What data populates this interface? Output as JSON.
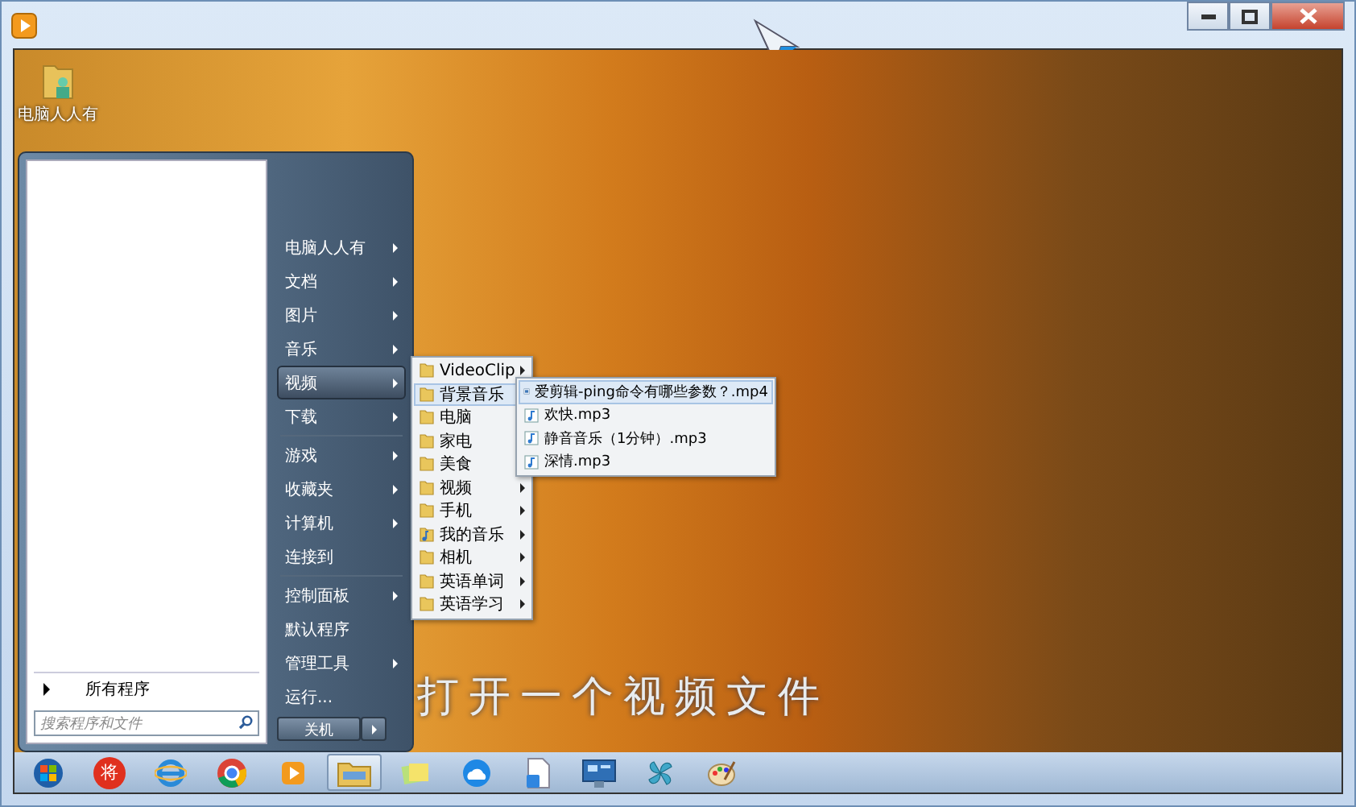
{
  "desktop_icons": [
    {
      "label": "电脑人人有"
    }
  ],
  "start_menu": {
    "all_programs": "所有程序",
    "search_placeholder": "搜索程序和文件",
    "shutdown": "关机",
    "items": [
      {
        "label": "电脑人人有",
        "has_submenu": true,
        "separator_before": false,
        "selected": false
      },
      {
        "label": "文档",
        "has_submenu": true,
        "separator_before": false,
        "selected": false
      },
      {
        "label": "图片",
        "has_submenu": true,
        "separator_before": false,
        "selected": false
      },
      {
        "label": "音乐",
        "has_submenu": true,
        "separator_before": false,
        "selected": false
      },
      {
        "label": "视频",
        "has_submenu": true,
        "separator_before": false,
        "selected": true
      },
      {
        "label": "下载",
        "has_submenu": true,
        "separator_before": false,
        "selected": false
      },
      {
        "label": "游戏",
        "has_submenu": true,
        "separator_before": true,
        "selected": false
      },
      {
        "label": "收藏夹",
        "has_submenu": true,
        "separator_before": false,
        "selected": false
      },
      {
        "label": "计算机",
        "has_submenu": true,
        "separator_before": false,
        "selected": false
      },
      {
        "label": "连接到",
        "has_submenu": false,
        "separator_before": false,
        "selected": false
      },
      {
        "label": "控制面板",
        "has_submenu": true,
        "separator_before": true,
        "selected": false
      },
      {
        "label": "默认程序",
        "has_submenu": false,
        "separator_before": false,
        "selected": false
      },
      {
        "label": "管理工具",
        "has_submenu": true,
        "separator_before": false,
        "selected": false
      },
      {
        "label": "运行...",
        "has_submenu": false,
        "separator_before": false,
        "selected": false
      }
    ]
  },
  "folder_menu": [
    {
      "label": "VideoClip",
      "kind": "folder",
      "selected": false
    },
    {
      "label": "背景音乐",
      "kind": "folder",
      "selected": true
    },
    {
      "label": "电脑",
      "kind": "folder",
      "selected": false
    },
    {
      "label": "家电",
      "kind": "folder",
      "selected": false
    },
    {
      "label": "美食",
      "kind": "folder",
      "selected": false
    },
    {
      "label": "视频",
      "kind": "folder",
      "selected": false
    },
    {
      "label": "手机",
      "kind": "folder",
      "selected": false
    },
    {
      "label": "我的音乐",
      "kind": "music",
      "selected": false
    },
    {
      "label": "相机",
      "kind": "folder",
      "selected": false
    },
    {
      "label": "英语单词",
      "kind": "folder",
      "selected": false
    },
    {
      "label": "英语学习",
      "kind": "folder",
      "selected": false
    }
  ],
  "file_menu": [
    {
      "label": "爱剪辑-ping命令有哪些参数？.mp4",
      "kind": "video",
      "selected": true
    },
    {
      "label": "欢快.mp3",
      "kind": "audio",
      "selected": false
    },
    {
      "label": "静音音乐（1分钟）.mp3",
      "kind": "audio",
      "selected": false
    },
    {
      "label": "深情.mp3",
      "kind": "audio",
      "selected": false
    }
  ],
  "subtitle": "打开一个视频文件",
  "taskbar": [
    {
      "kind": "start",
      "active": false
    },
    {
      "kind": "badge",
      "label": "将",
      "active": false
    },
    {
      "kind": "ie",
      "active": false
    },
    {
      "kind": "chrome",
      "active": false
    },
    {
      "kind": "player",
      "active": false
    },
    {
      "kind": "explorer",
      "active": true
    },
    {
      "kind": "notes",
      "active": false
    },
    {
      "kind": "cloud",
      "active": false
    },
    {
      "kind": "document",
      "active": false
    },
    {
      "kind": "remote",
      "active": false
    },
    {
      "kind": "pinwheel",
      "active": false
    },
    {
      "kind": "paint",
      "active": false
    }
  ]
}
